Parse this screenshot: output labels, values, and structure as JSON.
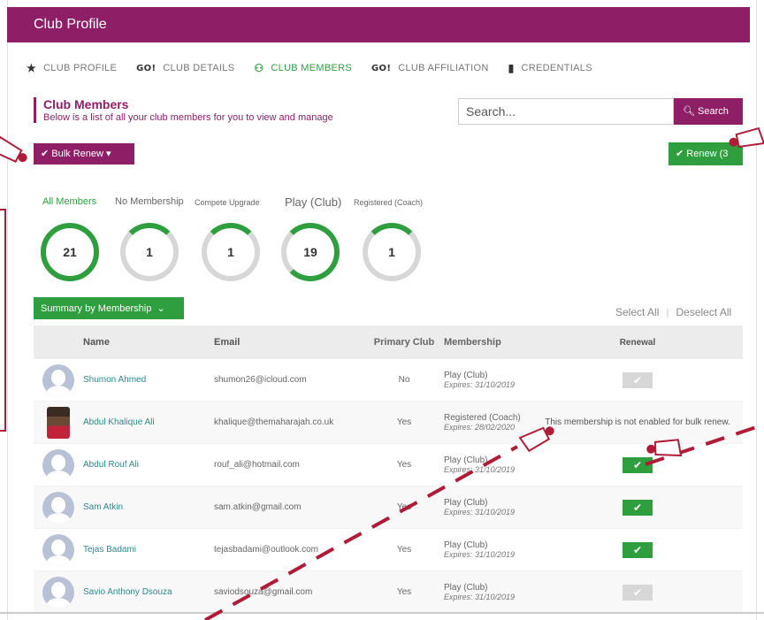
{
  "header": {
    "title": "Club Profile"
  },
  "nav": [
    {
      "icon": "star-icon",
      "glyph": "★",
      "label": "CLUB PROFILE",
      "active": false
    },
    {
      "icon": "go-icon",
      "glyph": "GO!",
      "label": "CLUB DETAILS",
      "active": false
    },
    {
      "icon": "members-icon",
      "glyph": "⚇",
      "label": "CLUB MEMBERS",
      "active": true
    },
    {
      "icon": "go-icon",
      "glyph": "GO!",
      "label": "CLUB AFFILIATION",
      "active": false
    },
    {
      "icon": "bookmark-icon",
      "glyph": "▮",
      "label": "CREDENTIALS",
      "active": false
    }
  ],
  "section": {
    "title": "Club Members",
    "subtitle": "Below is a list of all your club members for you to view and manage"
  },
  "search": {
    "placeholder": "Search...",
    "button_label": "Search",
    "icon": "search-icon"
  },
  "buttons": {
    "bulk_renew": "Bulk Renew",
    "renew": "Renew (3",
    "summary": "Summary by Membership",
    "select_all": "Select All",
    "deselect_all": "Deselect All"
  },
  "filters": [
    {
      "label": "All Members",
      "count": "21",
      "active": true
    },
    {
      "label": "No Membership",
      "count": "1",
      "active": false
    },
    {
      "label": "Compete Upgrade",
      "count": "1",
      "active": false
    },
    {
      "label": "Play (Club)",
      "count": "19",
      "active": false
    },
    {
      "label": "Registered (Coach)",
      "count": "1",
      "active": false
    }
  ],
  "table": {
    "headers": [
      "Name",
      "Email",
      "Primary Club",
      "Membership",
      "Renewal"
    ],
    "rows": [
      {
        "name": "Shumon Ahmed",
        "email": "shumon26@icloud.com",
        "primary": "No",
        "membership": "Play (Club)",
        "expires": "Expires: 31/10/2019",
        "renewal": "off"
      },
      {
        "name": "Abdul Khalique Ali",
        "email": "khalique@themaharajah.co.uk",
        "primary": "Yes",
        "membership": "Registered (Coach)",
        "expires": "Expires: 28/02/2020",
        "renewal": "text",
        "renewal_text": "This membership is not enabled for bulk renew."
      },
      {
        "name": "Abdul Rouf Ali",
        "email": "rouf_ali@hotmail.com",
        "primary": "Yes",
        "membership": "Play (Club)",
        "expires": "Expires: 31/10/2019",
        "renewal": "on"
      },
      {
        "name": "Sam Atkin",
        "email": "sam.atkin@gmail.com",
        "primary": "Yes",
        "membership": "Play (Club)",
        "expires": "Expires: 31/10/2019",
        "renewal": "on"
      },
      {
        "name": "Tejas Badami",
        "email": "tejasbadami@outlook.com",
        "primary": "Yes",
        "membership": "Play (Club)",
        "expires": "Expires: 31/10/2019",
        "renewal": "on"
      },
      {
        "name": "Savio Anthony Dsouza",
        "email": "saviodsouza@gmail.com",
        "primary": "Yes",
        "membership": "Play (Club)",
        "expires": "Expires: 31/10/2019",
        "renewal": "off"
      }
    ]
  },
  "colors": {
    "brand": "#8e1f67",
    "accent": "#2e9e3e",
    "annotation": "#b01c38"
  }
}
